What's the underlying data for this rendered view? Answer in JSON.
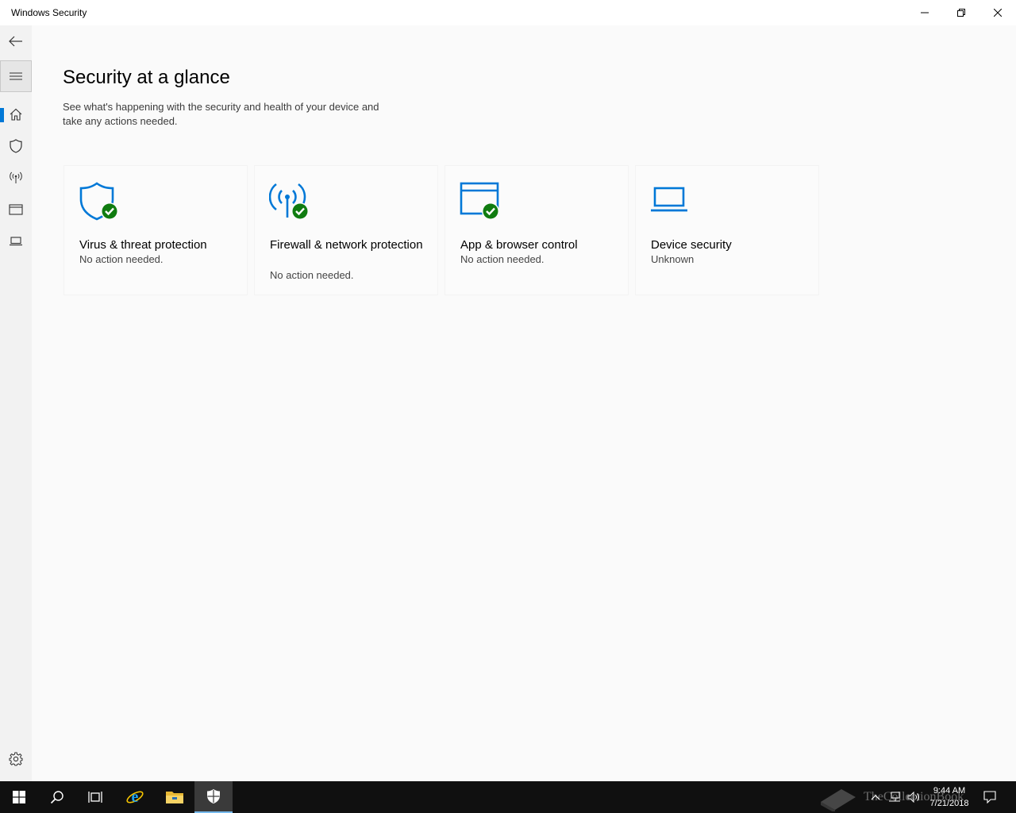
{
  "window": {
    "title": "Windows Security",
    "controls": [
      "minimize",
      "restore",
      "close"
    ]
  },
  "nav": {
    "items": [
      {
        "name": "back",
        "icon": "back-arrow-icon"
      },
      {
        "name": "menu",
        "icon": "hamburger-icon"
      },
      {
        "name": "home",
        "icon": "home-icon",
        "selected": true
      },
      {
        "name": "virus-threat",
        "icon": "shield-icon"
      },
      {
        "name": "firewall",
        "icon": "antenna-icon"
      },
      {
        "name": "app-browser",
        "icon": "browser-window-icon"
      },
      {
        "name": "device-security",
        "icon": "laptop-icon"
      },
      {
        "name": "settings",
        "icon": "gear-icon"
      }
    ]
  },
  "main": {
    "title": "Security at a glance",
    "description": "See what's happening with the security and health of your device and take any actions needed.",
    "cards": [
      {
        "title": "Virus & threat protection",
        "status": "No action needed.",
        "icon": "shield-check-icon",
        "ok": true
      },
      {
        "title": "Firewall & network protection",
        "status": "No action needed.",
        "icon": "antenna-check-icon",
        "ok": true
      },
      {
        "title": "App & browser control",
        "status": "No action needed.",
        "icon": "browser-check-icon",
        "ok": true
      },
      {
        "title": "Device security",
        "status": "Unknown",
        "icon": "laptop-icon",
        "ok": false
      }
    ]
  },
  "taskbar": {
    "apps": [
      "start-icon",
      "search-icon",
      "task-view-icon",
      "internet-explorer-icon",
      "file-explorer-icon",
      "windows-security-icon"
    ],
    "time": "9:44 AM",
    "date": "7/21/2018",
    "watermark": "TheCollectionBook"
  },
  "colors": {
    "accent": "#0078d7",
    "ok_green": "#107c10",
    "background": "#fafafa",
    "rail": "#f2f2f2",
    "taskbar": "#101010"
  }
}
